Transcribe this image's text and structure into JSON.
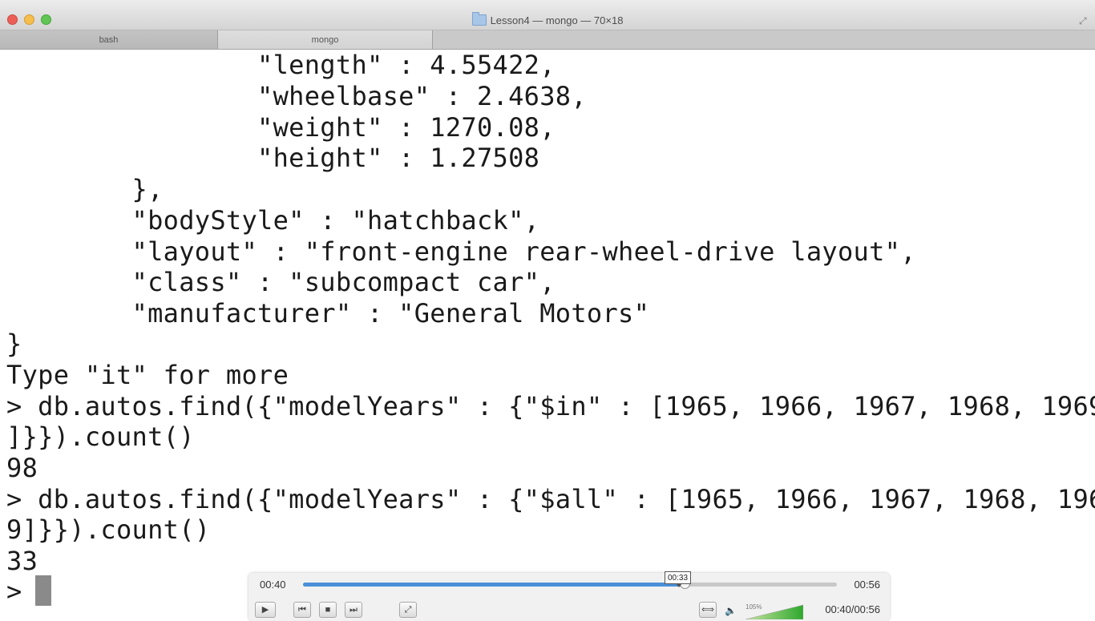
{
  "window": {
    "title": "Lesson4 — mongo — 70×18",
    "tabs": [
      {
        "label": "bash"
      },
      {
        "label": "mongo"
      }
    ]
  },
  "terminal": {
    "lines": [
      "                \"length\" : 4.55422,",
      "                \"wheelbase\" : 2.4638,",
      "                \"weight\" : 1270.08,",
      "                \"height\" : 1.27508",
      "        },",
      "        \"bodyStyle\" : \"hatchback\",",
      "        \"layout\" : \"front-engine rear-wheel-drive layout\",",
      "        \"class\" : \"subcompact car\",",
      "        \"manufacturer\" : \"General Motors\"",
      "}",
      "Type \"it\" for more",
      "> db.autos.find({\"modelYears\" : {\"$in\" : [1965, 1966, 1967, 1968, 1969",
      "]}}).count()",
      "98",
      "> db.autos.find({\"modelYears\" : {\"$all\" : [1965, 1966, 1967, 1968, 196",
      "9]}}).count()",
      "33",
      "> "
    ]
  },
  "player": {
    "elapsed": "00:40",
    "remaining": "00:56",
    "hover_time": "00:33",
    "combined_time": "00:40/00:56",
    "progress_fraction": 0.715,
    "volume_label": "105%",
    "accent_color": "#4a90d9",
    "icons": [
      "play-icon",
      "previous-icon",
      "stop-icon",
      "next-icon",
      "fullscreen-icon",
      "loop-icon",
      "volume-icon"
    ]
  }
}
